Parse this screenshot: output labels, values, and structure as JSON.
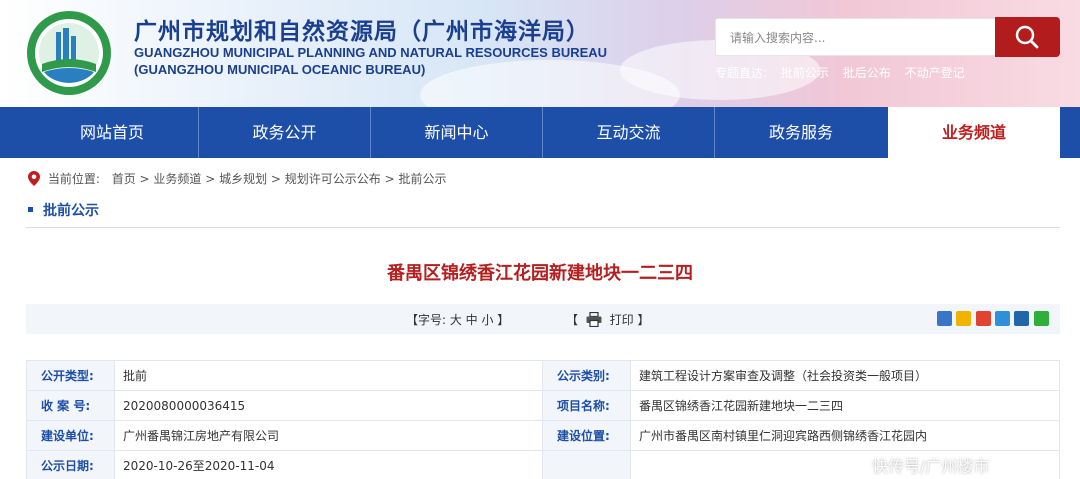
{
  "header": {
    "title_cn": "广州市规划和自然资源局（广州市海洋局）",
    "title_en_line1": "GUANGZHOU MUNICIPAL PLANNING AND NATURAL RESOURCES BUREAU",
    "title_en_line2": "(GUANGZHOU MUNICIPAL OCEANIC BUREAU)",
    "search_placeholder": "请输入搜索内容...",
    "quick_label": "专题直达:",
    "quick_links": [
      "批前公示",
      "批后公布",
      "不动产登记"
    ]
  },
  "nav": {
    "items": [
      "网站首页",
      "政务公开",
      "新闻中心",
      "互动交流",
      "政务服务",
      "业务频道"
    ],
    "active": "业务频道"
  },
  "breadcrumb": {
    "label": "当前位置:",
    "path": "首页 > 业务频道 > 城乡规划 > 规划许可公示公布 > 批前公示"
  },
  "section": {
    "title": "批前公示"
  },
  "article": {
    "title": "番禺区锦绣香江花园新建地块一二三四",
    "font_size_text": "【字号: 大 中 小 】",
    "print_prefix": "【",
    "print_text": "打印 】"
  },
  "info": {
    "rows": [
      {
        "k1": "公开类型:",
        "v1": "批前",
        "k2": "公示类别:",
        "v2": "建筑工程设计方案审查及调整（社会投资类一般项目）"
      },
      {
        "k1": "收 案 号:",
        "v1": "2020080000036415",
        "k2": "项目名称:",
        "v2": "番禺区锦绣香江花园新建地块一二三四"
      },
      {
        "k1": "建设单位:",
        "v1": "广州番禺锦江房地产有限公司",
        "k2": "建设位置:",
        "v2": "广州市番禺区南村镇里仁洞迎宾路西侧锦绣香江花园内"
      },
      {
        "k1": "公示日期:",
        "v1": "2020-10-26至2020-11-04",
        "k2": "",
        "v2": ""
      }
    ]
  },
  "watermark": "快传号/广州楼市",
  "colors": {
    "brand_blue": "#1e4fa8",
    "accent_red": "#b42020",
    "search_red": "#b31c1c"
  }
}
